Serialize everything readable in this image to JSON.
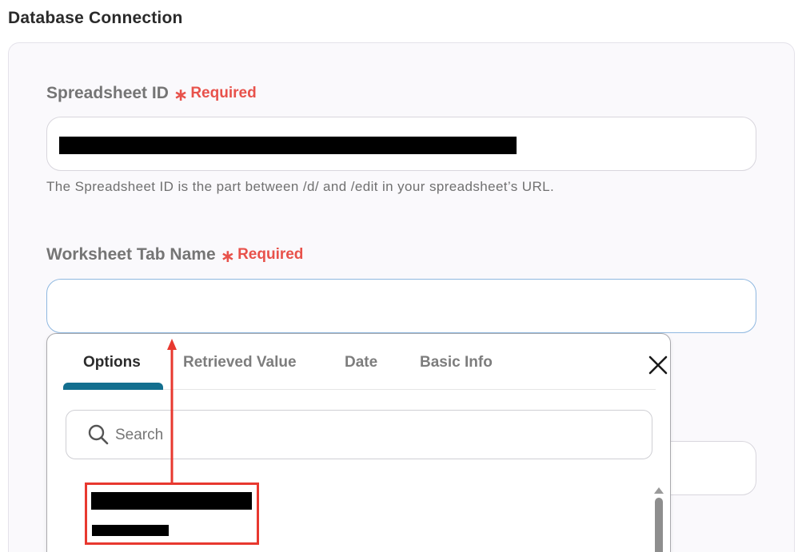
{
  "section": {
    "title": "Database Connection"
  },
  "spreadsheet_field": {
    "label": "Spreadsheet ID",
    "required_star": "∗",
    "required_text": "Required",
    "helper": "The Spreadsheet ID is the part between /d/ and /edit in your spreadsheet’s URL."
  },
  "worksheet_field": {
    "label": "Worksheet Tab Name",
    "required_star": "∗",
    "required_text": "Required"
  },
  "popover": {
    "tabs": [
      {
        "label": "Options",
        "active": true
      },
      {
        "label": "Retrieved Value",
        "active": false
      },
      {
        "label": "Date",
        "active": false
      },
      {
        "label": "Basic Info",
        "active": false
      }
    ],
    "search_placeholder": "Search"
  },
  "icons": {
    "close": "close-icon",
    "search": "search-icon",
    "required": "asterisk-icon",
    "scroll_up": "triangle-up-icon"
  },
  "colors": {
    "required": "#e8524b",
    "active_tab_underline": "#136f8f",
    "annotation": "#e8382f",
    "focus_border": "#8fb8e0"
  }
}
